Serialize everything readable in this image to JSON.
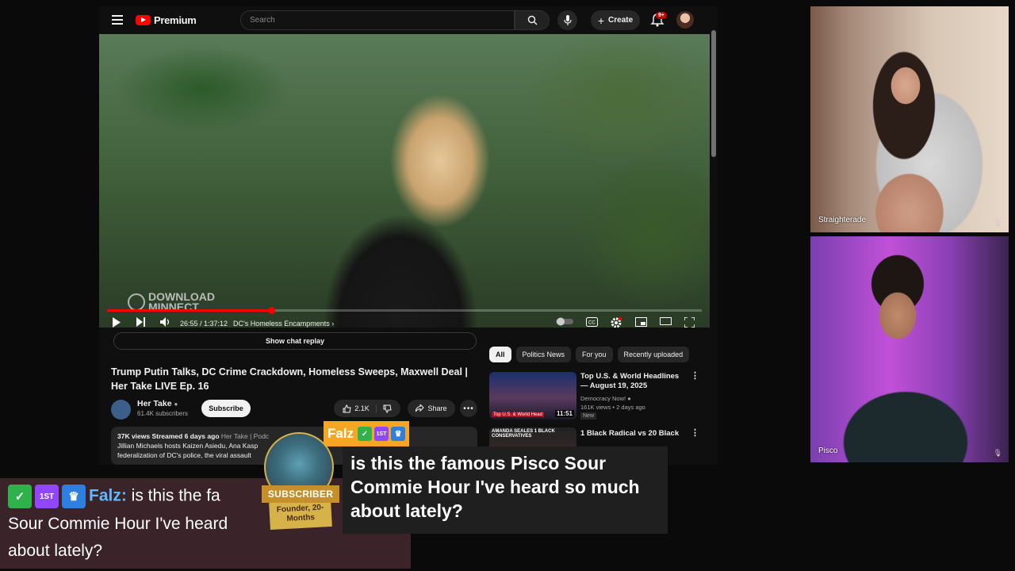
{
  "header": {
    "logo": "Premium",
    "search_placeholder": "Search",
    "create_label": "Create",
    "notifications_badge": "9+"
  },
  "player": {
    "watermark_line1": "DOWNLOAD",
    "watermark_line2": "MINNECT",
    "time": "26:55 / 1:37:12",
    "chapter": "DC's Homeless Encampments",
    "progress_fraction": 0.277
  },
  "show_chat_replay": "Show chat replay",
  "video": {
    "title": "Trump Putin Talks, DC Crime Crackdown, Homeless Sweeps, Maxwell Deal | Her Take LIVE Ep. 16",
    "channel": "Her Take",
    "subscribers": "61.4K subscribers",
    "subscribe_label": "Subscribe",
    "likes": "2.1K",
    "share_label": "Share",
    "desc_meta": "37K views  Streamed 6 days ago",
    "desc_tags": "Her Take | Podc",
    "desc_line2": "Jillian Michaels hosts Kaizen Asiedu, Ana Kasp",
    "desc_line3": "federalization of DC's police, the viral assault"
  },
  "chips": [
    "All",
    "Politics News",
    "For you",
    "Recently uploaded"
  ],
  "recommendations": [
    {
      "title": "Top U.S. & World Headlines — August 19, 2025",
      "channel": "Democracy Now!",
      "stats": "161K views • 2 days ago",
      "duration": "11:51",
      "badge": "New",
      "thumb_label": "Top U.S. & World Head"
    },
    {
      "title": "1 Black Radical vs 20 Black",
      "thumb_label": "AMANDA SEALES 1 BLACK CONSERVATIVES"
    }
  ],
  "cams": [
    {
      "name": "Straighterade"
    },
    {
      "name": "Pisco"
    }
  ],
  "chat": {
    "user": "Falz",
    "badge_first": "1ST",
    "line1_text": " is this the fa",
    "line2": "Sour Commie Hour I've heard",
    "line3": "about lately?",
    "popup_message": "is this the famous Pisco Sour Commie Hour I've heard so much about lately?",
    "sub_ribbon": "SUBSCRIBER",
    "sub_scroll": "Founder, 20-Months"
  },
  "colors": {
    "yt_red": "#ff0000",
    "chat_username": "#5fb8ff",
    "popup_name_bg": "#f5a623",
    "chat_strip_bg": "#3a2329"
  }
}
